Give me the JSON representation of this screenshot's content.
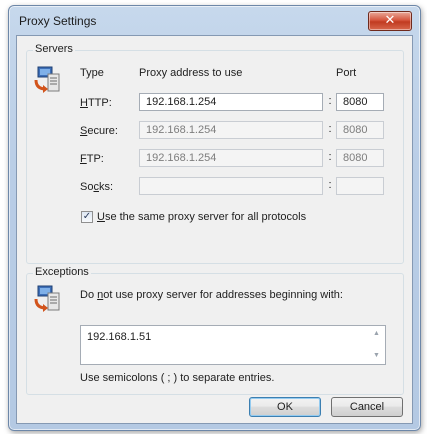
{
  "window": {
    "title": "Proxy Settings",
    "close_glyph": "✕"
  },
  "servers": {
    "group_label": "Servers",
    "headers": {
      "type": "Type",
      "address": "Proxy address to use",
      "port": "Port"
    },
    "rows": [
      {
        "label_pre": "",
        "label_u": "H",
        "label_post": "TTP:",
        "address": "192.168.1.254",
        "port": "8080",
        "disabled": false
      },
      {
        "label_pre": "",
        "label_u": "S",
        "label_post": "ecure:",
        "address": "192.168.1.254",
        "port": "8080",
        "disabled": true
      },
      {
        "label_pre": "",
        "label_u": "F",
        "label_post": "TP:",
        "address": "192.168.1.254",
        "port": "8080",
        "disabled": true
      },
      {
        "label_pre": "So",
        "label_u": "c",
        "label_post": "ks:",
        "address": "",
        "port": "",
        "disabled": true
      }
    ],
    "colon": ":",
    "same_proxy": {
      "checked": true,
      "label_u": "U",
      "label_rest": "se the same proxy server for all protocols"
    }
  },
  "exceptions": {
    "group_label": "Exceptions",
    "description_pre": "Do ",
    "description_u": "n",
    "description_post": "ot use proxy server for addresses beginning with:",
    "value": "192.168.1.51",
    "hint": "Use semicolons ( ; ) to separate entries."
  },
  "buttons": {
    "ok": "OK",
    "cancel": "Cancel"
  },
  "icons": {
    "network": "network-computer-icon",
    "close": "close-icon",
    "check": "checkmark-icon"
  },
  "colors": {
    "close_button": "#c13b20",
    "frame": "#b9cde6",
    "client": "#f0f0f0"
  }
}
